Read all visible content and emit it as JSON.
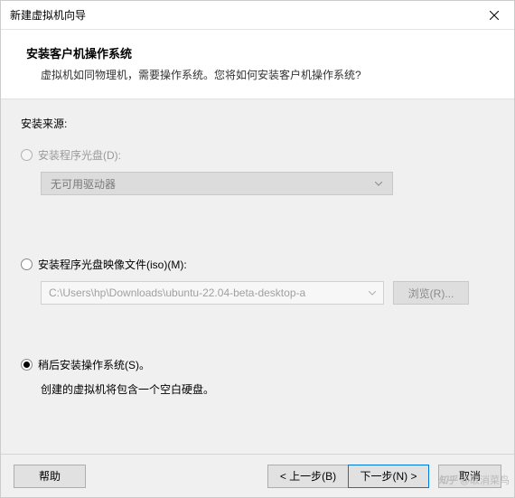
{
  "titlebar": {
    "title": "新建虚拟机向导"
  },
  "header": {
    "title": "安装客户机操作系统",
    "desc": "虚拟机如同物理机，需要操作系统。您将如何安装客户机操作系统?"
  },
  "content": {
    "source_label": "安装来源:",
    "option_disc": {
      "label": "安装程序光盘(D):",
      "dropdown": "无可用驱动器"
    },
    "option_iso": {
      "label": "安装程序光盘映像文件(iso)(M):",
      "path": "C:\\Users\\hp\\Downloads\\ubuntu-22.04-beta-desktop-a",
      "browse": "浏览(R)..."
    },
    "option_later": {
      "label": "稍后安装操作系统(S)。",
      "desc": "创建的虚拟机将包含一个空白硬盘。"
    }
  },
  "buttons": {
    "help": "帮助",
    "back": "< 上一步(B)",
    "next": "下一步(N) >",
    "cancel": "取消"
  },
  "watermark": {
    "logo": "知乎",
    "text": "@取消菜鸟"
  }
}
